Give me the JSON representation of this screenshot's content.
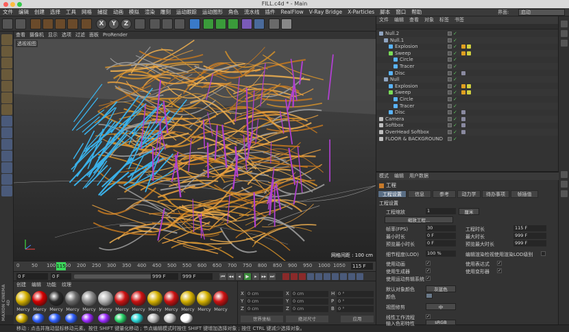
{
  "window": {
    "title": "FILL.c4d * - Main"
  },
  "menubar": {
    "items": [
      "文件",
      "编辑",
      "创建",
      "选择",
      "工具",
      "网格",
      "捕捉",
      "动画",
      "模拟",
      "渲染",
      "雕刻",
      "运动跟踪",
      "运动图形",
      "角色",
      "流水线",
      "插件",
      "RealFlow",
      "V-Ray Bridge",
      "X-Particles",
      "脚本",
      "窗口",
      "帮助"
    ],
    "layout_label": "界面:",
    "layout_value": "启动"
  },
  "toolbar": {
    "axes": [
      "X",
      "Y",
      "Z"
    ],
    "icons": [
      "undo-icon",
      "redo-icon",
      "select-icon",
      "move-icon",
      "scale-icon",
      "rotate-icon",
      "recent-icon",
      "axis-x-icon",
      "axis-y-icon",
      "axis-z-icon",
      "coord-system-icon",
      "film-render-icon",
      "render-view-icon",
      "render-settings-icon",
      "cube-icon",
      "pen-icon",
      "subdivision-icon",
      "cloner-icon",
      "deformer-icon",
      "scene-icon",
      "camera-icon",
      "light-icon"
    ]
  },
  "viewport": {
    "menu": [
      "查看",
      "摄像机",
      "显示",
      "选项",
      "过滤",
      "面板",
      "ProRender"
    ],
    "label": "透视视图",
    "grid_info": "网格间距 : 100 cm"
  },
  "timeline": {
    "ticks": [
      "0",
      "50",
      "100",
      "150",
      "200",
      "250",
      "300",
      "350",
      "400",
      "450",
      "500",
      "550",
      "600",
      "650",
      "700",
      "750",
      "800",
      "850",
      "900",
      "950",
      "1000",
      "1050"
    ],
    "current_frame": "115 F",
    "frame_marker": "115"
  },
  "playback": {
    "start": "0 F",
    "min": "0 F",
    "max": "999 F",
    "end": "999 F",
    "buttons": [
      "first-frame-icon",
      "prev-key-icon",
      "prev-frame-icon",
      "play-icon",
      "next-frame-icon",
      "next-key-icon",
      "last-frame-icon"
    ]
  },
  "materials": {
    "menu": [
      "创建",
      "编辑",
      "功能",
      "纹理"
    ],
    "row1_labels": [
      "Mercy",
      "Mercy",
      "Mercy",
      "Mercy",
      "Mercy",
      "Mercy",
      "Mercy",
      "Mercy",
      "Mercy",
      "Mercy",
      "Mercy",
      "Mercy",
      "Mercy"
    ],
    "row1_colors": [
      "#d4b000",
      "#d40000",
      "#2a2a2a",
      "#6a6a6a",
      "#8a8a8a",
      "#b0b0b0",
      "#cc1111",
      "#cc1111",
      "#d4b000",
      "#cc1111",
      "#d4b000",
      "#d4b000",
      "#cc1111"
    ],
    "row2_colors": [
      "#d4b000",
      "#3060ff",
      "#3060ff",
      "#3060ff",
      "#9a2aff",
      "#9a2aff",
      "#2ad46a",
      "#2ad4d4",
      "#bbbbbb",
      "#c8c8c8",
      "#ffffff"
    ]
  },
  "coords": {
    "rows": [
      {
        "a": "X",
        "av": "0 cm",
        "b": "X",
        "bv": "0 cm",
        "c": "H",
        "cv": "0 °"
      },
      {
        "a": "Y",
        "av": "0 cm",
        "b": "Y",
        "bv": "0 cm",
        "c": "P",
        "cv": "0 °"
      },
      {
        "a": "Z",
        "av": "0 cm",
        "b": "Z",
        "bv": "0 cm",
        "c": "B",
        "cv": "0 °"
      }
    ],
    "mode": "世界坐标",
    "scale": "绝对尺寸",
    "apply": "应用"
  },
  "status": "移动 : 点击并拖动鼠标移动元素。按住 SHIFT 键量化移动 ; 节点编辑模式时按住 SHIFT 键增加选择对象 ; 按住 CTRL 键减少选择对象。",
  "brand": "MAXON CINEMA 4D",
  "objects": {
    "menu": [
      "文件",
      "编辑",
      "查看",
      "对象",
      "标签",
      "书签"
    ],
    "rows": [
      {
        "name": "Null.2",
        "indent": 0,
        "icon": "#8fa4c0"
      },
      {
        "name": "Null.1",
        "indent": 1,
        "icon": "#8fa4c0"
      },
      {
        "name": "Explosion",
        "indent": 2,
        "icon": "#5ab4ff"
      },
      {
        "name": "Sweep",
        "indent": 2,
        "icon": "#7adc58"
      },
      {
        "name": "Circle",
        "indent": 3,
        "icon": "#5ab4ff"
      },
      {
        "name": "Tracer",
        "indent": 3,
        "icon": "#5ab4ff"
      },
      {
        "name": "Disc",
        "indent": 2,
        "icon": "#5ab4ff"
      },
      {
        "name": "Null",
        "indent": 1,
        "icon": "#8fa4c0"
      },
      {
        "name": "Explosion",
        "indent": 2,
        "icon": "#5ab4ff"
      },
      {
        "name": "Sweep",
        "indent": 2,
        "icon": "#7adc58"
      },
      {
        "name": "Circle",
        "indent": 3,
        "icon": "#5ab4ff"
      },
      {
        "name": "Tracer",
        "indent": 3,
        "icon": "#5ab4ff"
      },
      {
        "name": "Disc",
        "indent": 2,
        "icon": "#5ab4ff"
      },
      {
        "name": "Camera",
        "indent": 0,
        "icon": "#c0c0c0"
      },
      {
        "name": "Softbox",
        "indent": 0,
        "icon": "#c0c0c0"
      },
      {
        "name": "OverHead Softbox",
        "indent": 0,
        "icon": "#c0c0c0"
      },
      {
        "name": "FLOOR & BACKGROUND",
        "indent": 0,
        "icon": "#c0c0c0"
      }
    ]
  },
  "attributes": {
    "menu": [
      "模式",
      "编辑",
      "用户数据"
    ],
    "title": "工程",
    "tabs": [
      "工程设置",
      "信息",
      "参考",
      "动力学",
      "待办事项",
      "帧插值"
    ],
    "section": "工程设置",
    "scale_label": "工程缩放",
    "scale_value": "1",
    "scale_unit": "厘米",
    "scale_button": "缩放工程...",
    "fps_label": "帧率(FPS)",
    "fps_value": "30",
    "doc_time_label": "工程时长",
    "doc_time_value": "115 F",
    "min_time_label": "最小时长",
    "min_time_value": "0 F",
    "max_time_label": "最大时长",
    "max_time_value": "999 F",
    "prev_min_label": "预览最小时长",
    "prev_min_value": "0 F",
    "prev_max_label": "预览最大时长",
    "prev_max_value": "999 F",
    "lod_label": "细节程度(LOD)",
    "lod_value": "100 %",
    "lod_check": "编辑渲染检视使用渲染LOD级别",
    "use_anim": "使用动画",
    "use_expr": "使用表达式",
    "use_gen": "使用生成器",
    "use_deform": "使用变形器",
    "use_motion": "使用运动剪辑系统",
    "def_color_label": "默认对象颜色",
    "def_color_value": "灰蓝色",
    "color_label": "颜色",
    "view_clip_label": "视图修剪",
    "view_clip_value": "中",
    "linear_label": "线性工作流程",
    "input_color_label": "输入色彩特性",
    "input_color_value": "sRGB"
  }
}
